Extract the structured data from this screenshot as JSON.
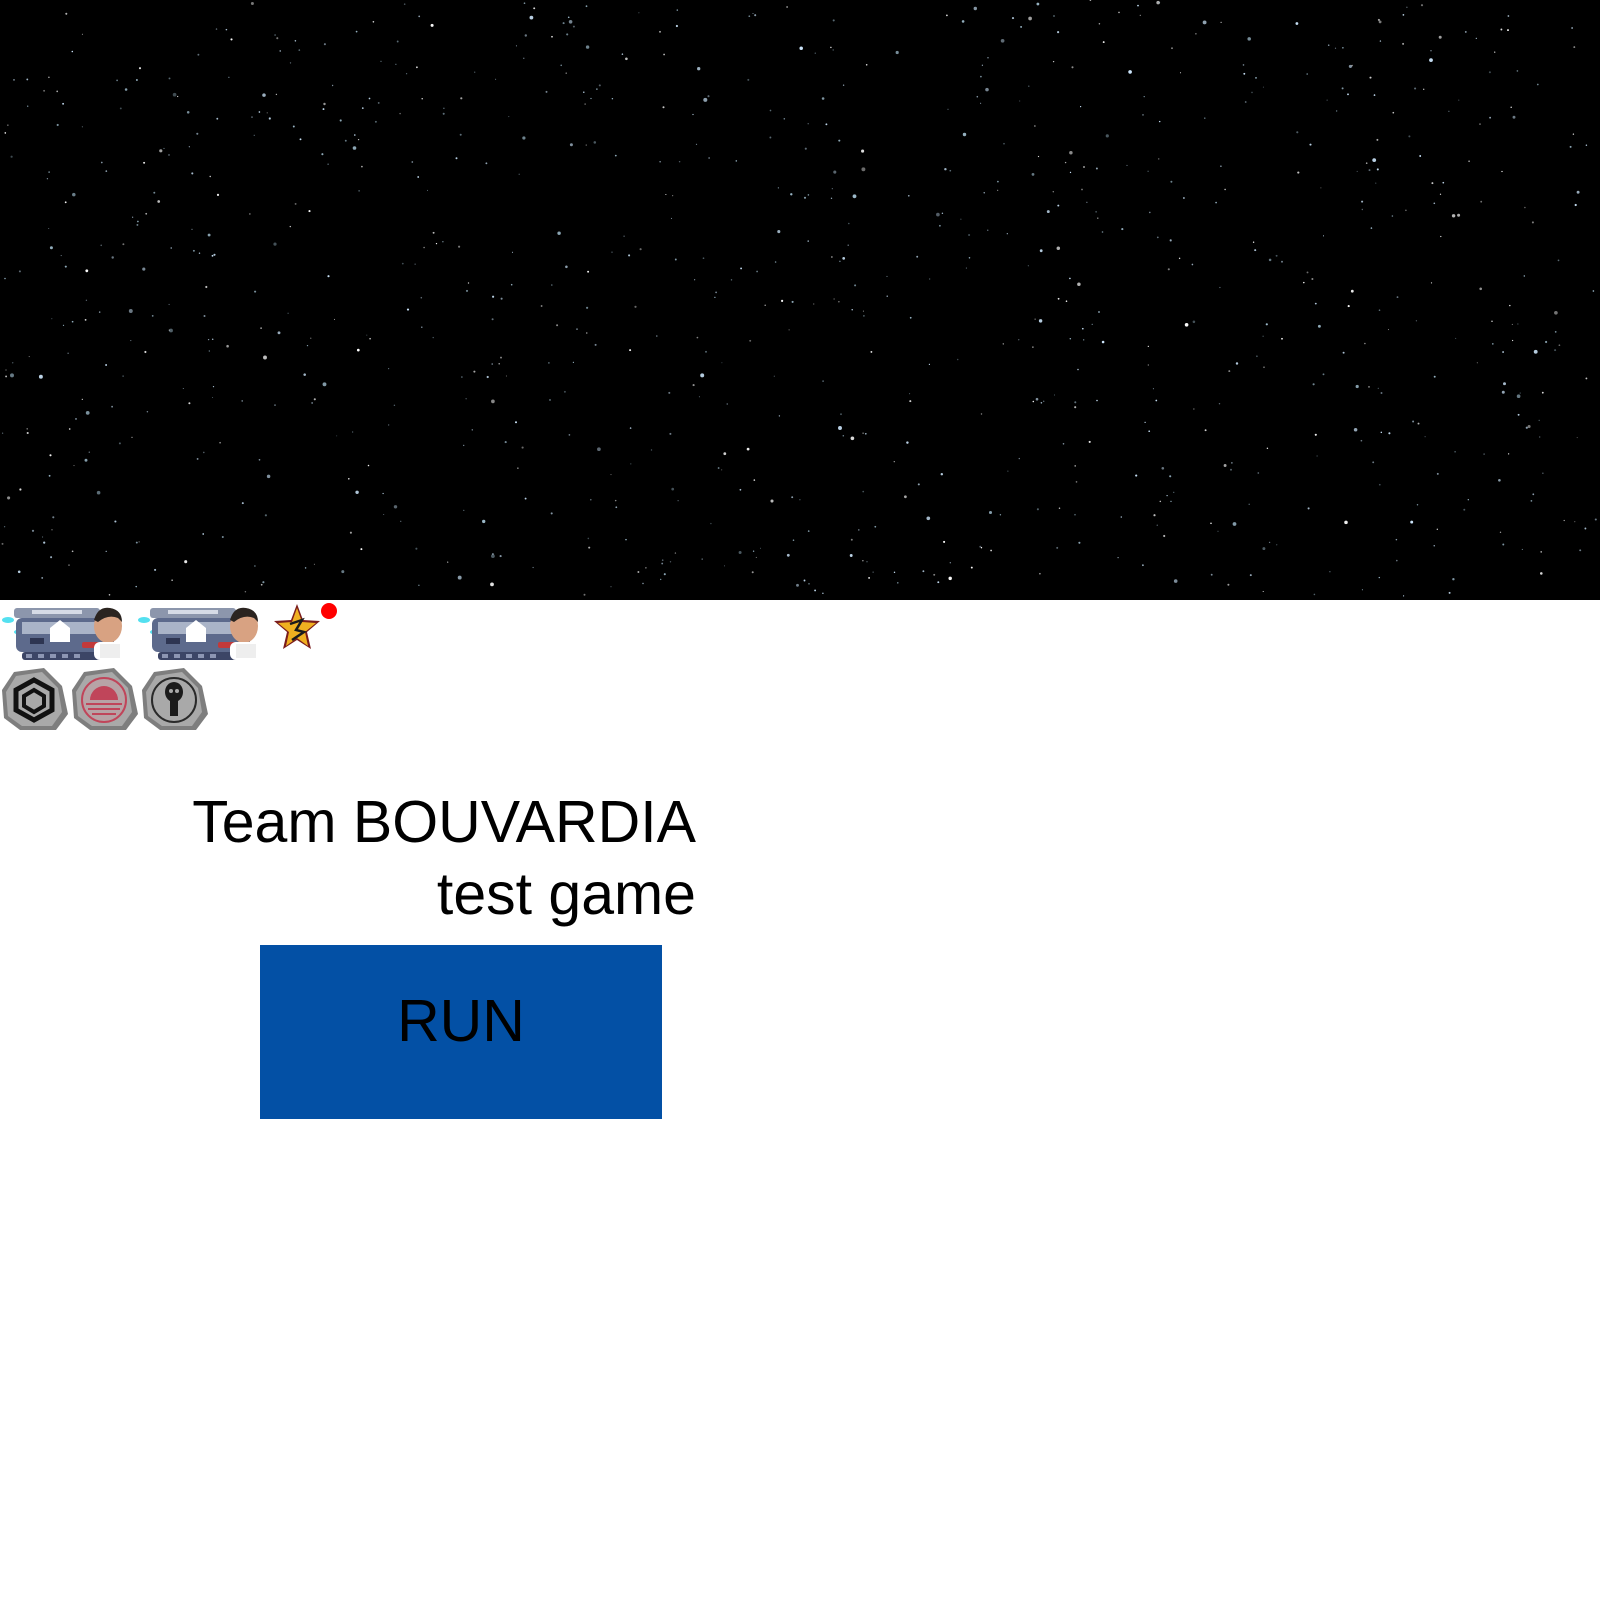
{
  "scene": {
    "background_top": "starfield",
    "background_top_color": "#000000",
    "background_bottom_color": "#ffffff"
  },
  "hud": {
    "ships": [
      {
        "icon": "spaceship-with-pilot-icon"
      },
      {
        "icon": "spaceship-with-pilot-icon"
      }
    ],
    "badge": {
      "icon": "star-badge-icon"
    },
    "notification": {
      "icon": "red-dot-icon",
      "color": "#ff0000"
    },
    "runes": [
      {
        "icon": "hexagon-rune-stone-icon",
        "accent": "#111111"
      },
      {
        "icon": "sun-rune-stone-icon",
        "accent": "#c0455a"
      },
      {
        "icon": "skull-rune-stone-icon",
        "accent": "#111111"
      }
    ]
  },
  "title": {
    "line1": "Team BOUVARDIA",
    "line2": "test game"
  },
  "run_button": {
    "label": "RUN",
    "color": "#0350a5"
  }
}
